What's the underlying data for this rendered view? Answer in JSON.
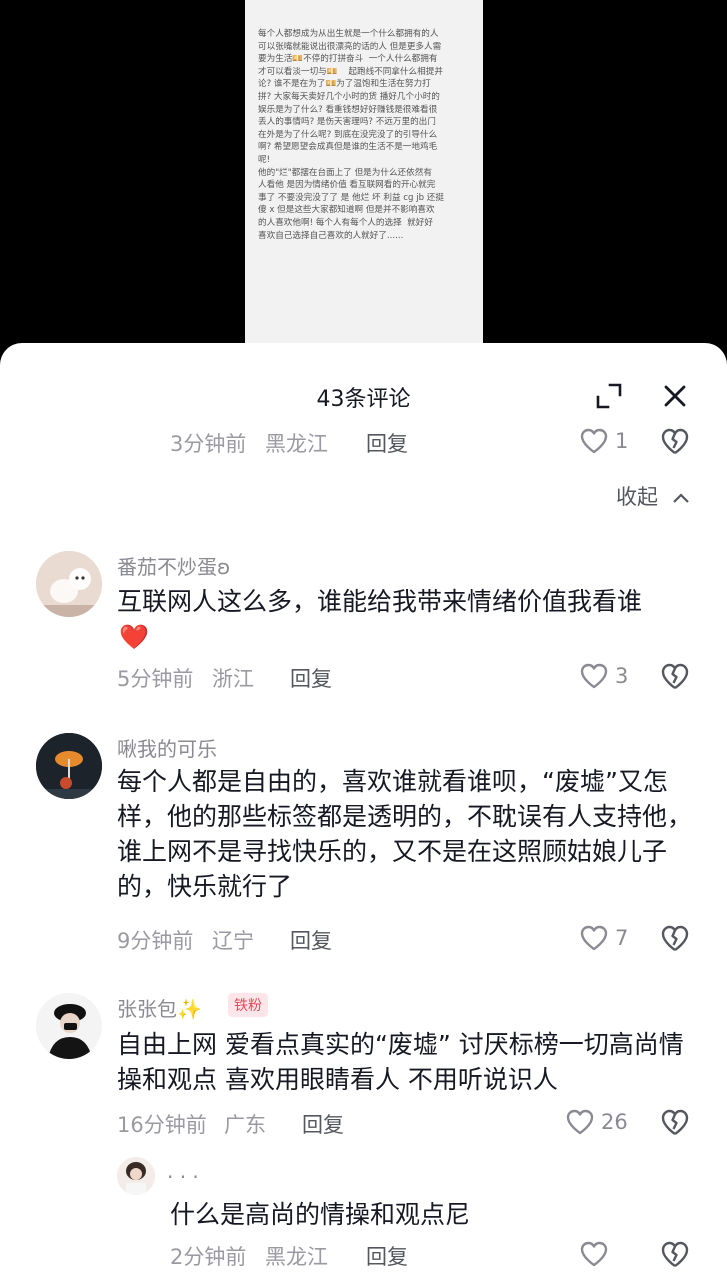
{
  "media": {
    "text": "每个人都想成为从出生就是一个什么都拥有的人\n可以张嘴就能说出很漂亮的话的人 但是更多人需\n要为生活💴不停的打拼奋斗  一个人什么都拥有\n才可以看淡一切与💴    起跑线不同拿什么相提并\n论? 谁不是在为了💴为了温饱和生活在努力打\n拼? 大家每天卖好几个小时的货 播好几个小时的\n娱乐是为了什么? 看重钱想好好赚钱是很难看很\n丢人的事情吗? 是伤天害理吗? 不远万里的出门\n在外是为了什么呢? 到底在没完没了的引导什么\n啊? 希望愿望会成真但是谁的生活不是一地鸡毛\n呢!\n他的\"烂\"都摆在台面上了 但是为什么还依然有\n人看他 是因为情绪价值 看互联网看的开心就完\n事了 不要没完没了了 是 他烂 坏 利益 cg jb 还挺\n傻 x 但是这些大家都知道啊 但是并不影响喜欢\n的人喜欢他啊! 每个人有每个人的选择  就好好\n喜欢自己选择自己喜欢的人就好了......"
  },
  "sheet": {
    "title": "43条评论"
  },
  "reply_label": "回复",
  "collapse_label": "收起",
  "prev_reply": {
    "time": "3分钟前",
    "location": "黑龙江",
    "likes": "1"
  },
  "comments": [
    {
      "author": "番茄不炒蛋ʚ",
      "text": "互联网人这么多，谁能给我带来情绪价值我看谁",
      "emoji": "❤️",
      "time": "5分钟前",
      "location": "浙江",
      "likes": "3"
    },
    {
      "author": "啾我的可乐",
      "text": "每个人都是自由的，喜欢谁就看谁呗，“废墟”又怎样，他的那些标签都是透明的，不耽误有人支持他，谁上网不是寻找快乐的，又不是在这照顾姑娘儿子的，快乐就行了",
      "time": "9分钟前",
      "location": "辽宁",
      "likes": "7"
    },
    {
      "author": "张张包✨",
      "badge": "铁粉",
      "text": "自由上网 爱看点真实的“废墟” 讨厌标榜一切高尚情操和观点 喜欢用眼睛看人 不用听说识人",
      "time": "16分钟前",
      "location": "广东",
      "likes": "26"
    }
  ],
  "sub_reply": {
    "author": ". . .",
    "text": "什么是高尚的情操和观点尼",
    "time": "2分钟前",
    "location": "黑龙江"
  },
  "colors": {
    "like_stroke": "#8a8a92",
    "text": "#161823",
    "meta": "#9a9aa2"
  }
}
